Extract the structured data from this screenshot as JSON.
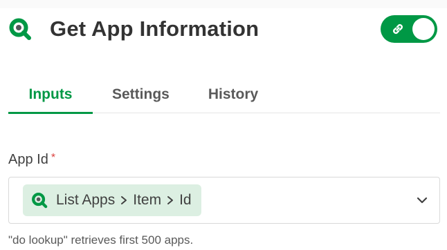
{
  "header": {
    "title": "Get App Information",
    "logo_icon": "qlik-icon",
    "toggle_icon": "link-icon",
    "toggle_on": true
  },
  "tabs": [
    {
      "label": "Inputs",
      "active": true
    },
    {
      "label": "Settings",
      "active": false
    },
    {
      "label": "History",
      "active": false
    }
  ],
  "field": {
    "label": "App Id",
    "required_mark": "*",
    "chip": {
      "icon": "qlik-icon",
      "parts": [
        "List Apps",
        "Item",
        "Id"
      ]
    },
    "helper": "\"do lookup\" retrieves first 500 apps."
  },
  "colors": {
    "brand": "#009845",
    "chip_bg": "#dcefe2",
    "required": "#dc423f",
    "text": "#404040"
  }
}
